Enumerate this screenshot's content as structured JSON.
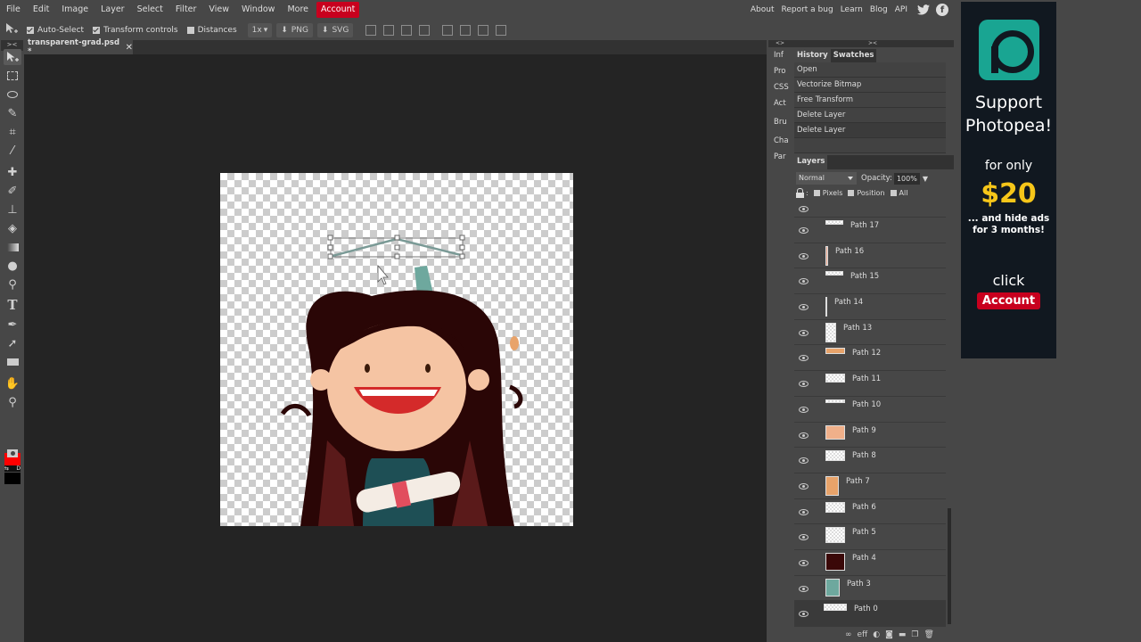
{
  "menu": {
    "items": [
      "File",
      "Edit",
      "Image",
      "Layer",
      "Select",
      "Filter",
      "View",
      "Window",
      "More"
    ],
    "account": "Account"
  },
  "toplinks": [
    "About",
    "Report a bug",
    "Learn",
    "Blog",
    "API"
  ],
  "social": {
    "twitter": "twitter-icon",
    "facebook": "facebook-icon"
  },
  "options": {
    "auto_select": {
      "label": "Auto-Select",
      "checked": true
    },
    "transform_controls": {
      "label": "Transform controls",
      "checked": true
    },
    "distances": {
      "label": "Distances",
      "checked": false
    },
    "zoom": "1x",
    "png": "PNG",
    "svg": "SVG"
  },
  "document": {
    "tab": "transparent-grad.psd *",
    "close": "✕"
  },
  "tools": [
    "move",
    "rect-select",
    "lasso",
    "quick-select",
    "crop",
    "eyedropper",
    "healing",
    "brush",
    "clone-stamp",
    "eraser",
    "gradient",
    "blur",
    "dodge",
    "type",
    "pen",
    "path-select",
    "shape",
    "hand",
    "zoom"
  ],
  "colors": {
    "foreground": "#ff0000",
    "background": "#000000",
    "accent": "#c8001e",
    "ad_teal": "#19a592",
    "ad_yellow": "#f6c619"
  },
  "minipanel": {
    "collapse": "<>",
    "items": [
      "Inf",
      "Pro",
      "CSS",
      "Act",
      "Bru",
      "Cha",
      "Par"
    ]
  },
  "panels": {
    "collapse": ">< ",
    "tabs": [
      "History",
      "Swatches"
    ],
    "history": [
      "Open",
      "Vectorize Bitmap",
      "Free Transform",
      "Delete Layer",
      "Delete Layer"
    ],
    "layers_tab": "Layers",
    "blend_mode": "Normal",
    "opacity_label": "Opacity:",
    "opacity": "100%",
    "lock_label": ":",
    "locks": [
      "Pixels",
      "Position",
      "All"
    ],
    "layers": [
      {
        "name": "Path 17"
      },
      {
        "name": "Path 16"
      },
      {
        "name": "Path 15"
      },
      {
        "name": "Path 14"
      },
      {
        "name": "Path 13"
      },
      {
        "name": "Path 12"
      },
      {
        "name": "Path 11"
      },
      {
        "name": "Path 10"
      },
      {
        "name": "Path 9"
      },
      {
        "name": "Path 8"
      },
      {
        "name": "Path 7"
      },
      {
        "name": "Path 6"
      },
      {
        "name": "Path 5"
      },
      {
        "name": "Path 4"
      },
      {
        "name": "Path 3"
      },
      {
        "name": "Path 0",
        "selected": true
      }
    ],
    "footer": [
      "link",
      "eff",
      "adjustment",
      "mask",
      "folder",
      "new-layer",
      "delete"
    ],
    "footer_eff": "eff"
  },
  "ad": {
    "line1": "Support",
    "line2": "Photopea!",
    "for_only": "for only",
    "price": "$20",
    "hide1": "... and hide ads",
    "hide2": "for 3 months!",
    "click": "click",
    "button": "Account"
  }
}
